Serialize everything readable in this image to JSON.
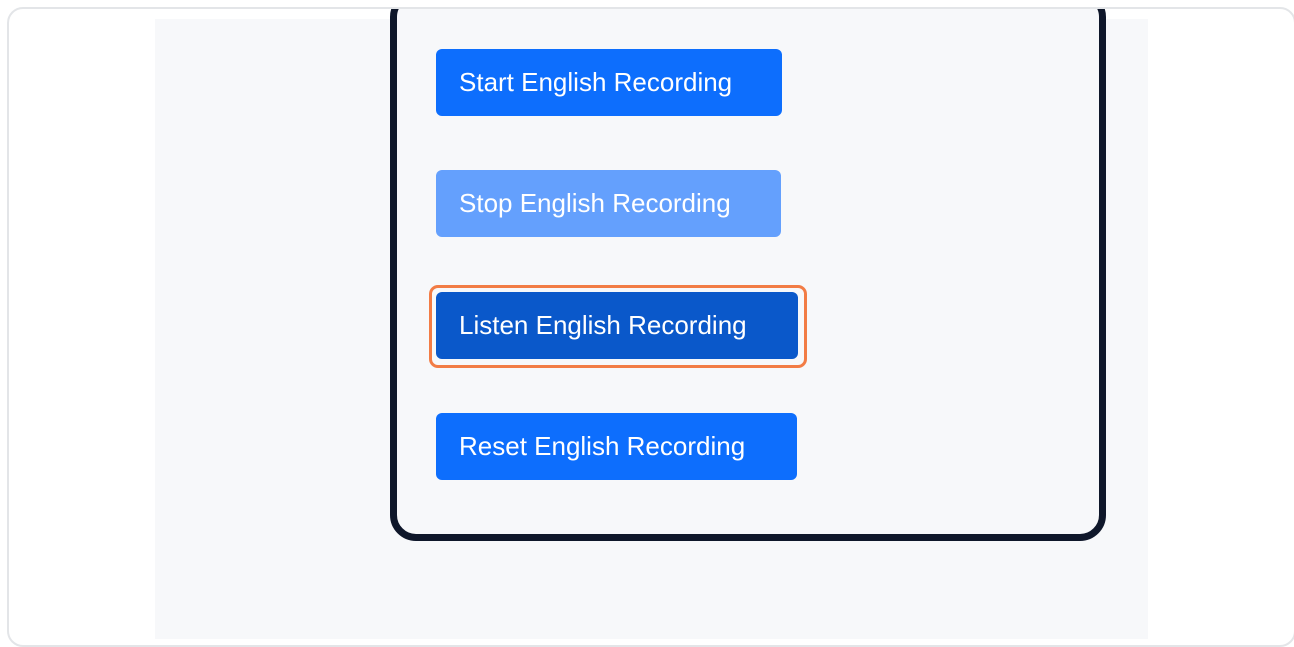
{
  "buttons": {
    "start": "Start English Recording",
    "stop": "Stop English Recording",
    "listen": "Listen English Recording",
    "reset": "Reset English Recording"
  },
  "colors": {
    "primary": "#0d6efd",
    "disabled": "#64a0fd",
    "active": "#0a58ca",
    "card_border": "#0f172a",
    "highlight": "#f27c45",
    "page_bg": "#f7f8fa"
  }
}
